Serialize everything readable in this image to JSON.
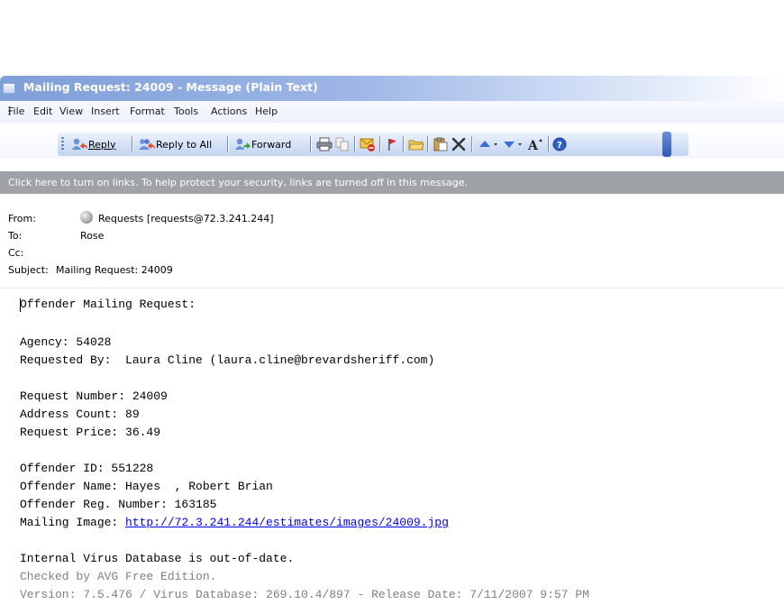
{
  "window": {
    "title": "Mailing Request: 24009 - Message (Plain Text)"
  },
  "menu": {
    "items": [
      "File",
      "Edit",
      "View",
      "Insert",
      "Format",
      "Tools",
      "Actions",
      "Help"
    ]
  },
  "toolbar": {
    "reply_label": "Reply",
    "reply_all_label": "Reply to All",
    "forward_label": "Forward"
  },
  "infobar": {
    "text": "Click here to turn on links. To help protect your security, links are turned off in this message."
  },
  "header": {
    "from_label": "From:",
    "from_value": "Requests [requests@72.3.241.244]",
    "to_label": "To:",
    "to_value": "Rose",
    "cc_label": "Cc:",
    "cc_value": "",
    "subject_label": "Subject:",
    "subject_value": "Mailing Request: 24009"
  },
  "message": {
    "heading": "Offender Mailing Request:",
    "agency": "Agency: 54028",
    "requested_by": "Requested By:  Laura Cline (laura.cline@brevardsheriff.com)",
    "request_number": "Request Number: 24009",
    "address_count": "Address Count: 89",
    "request_price": "Request Price: 36.49",
    "offender_id": "Offender ID: 551228",
    "offender_name": "Offender Name: Hayes  , Robert Brian",
    "offender_reg": "Offender Reg. Number: 163185",
    "mailing_image_label": "Mailing Image: ",
    "mailing_image_url": "http://72.3.241.244/estimates/images/24009.jpg",
    "virus_line1": "Internal Virus Database is out-of-date.",
    "virus_line2": "Checked by AVG Free Edition.",
    "virus_line3": "Version: 7.5.476 / Virus Database: 269.10.4/897 - Release Date: 7/11/2007 9:57 PM"
  },
  "colors": {
    "titlebar_accent": "#7f9fd8",
    "infobar_bg": "#9fa3a8",
    "header_bg": "#ffffff",
    "link": "#0000ee"
  }
}
